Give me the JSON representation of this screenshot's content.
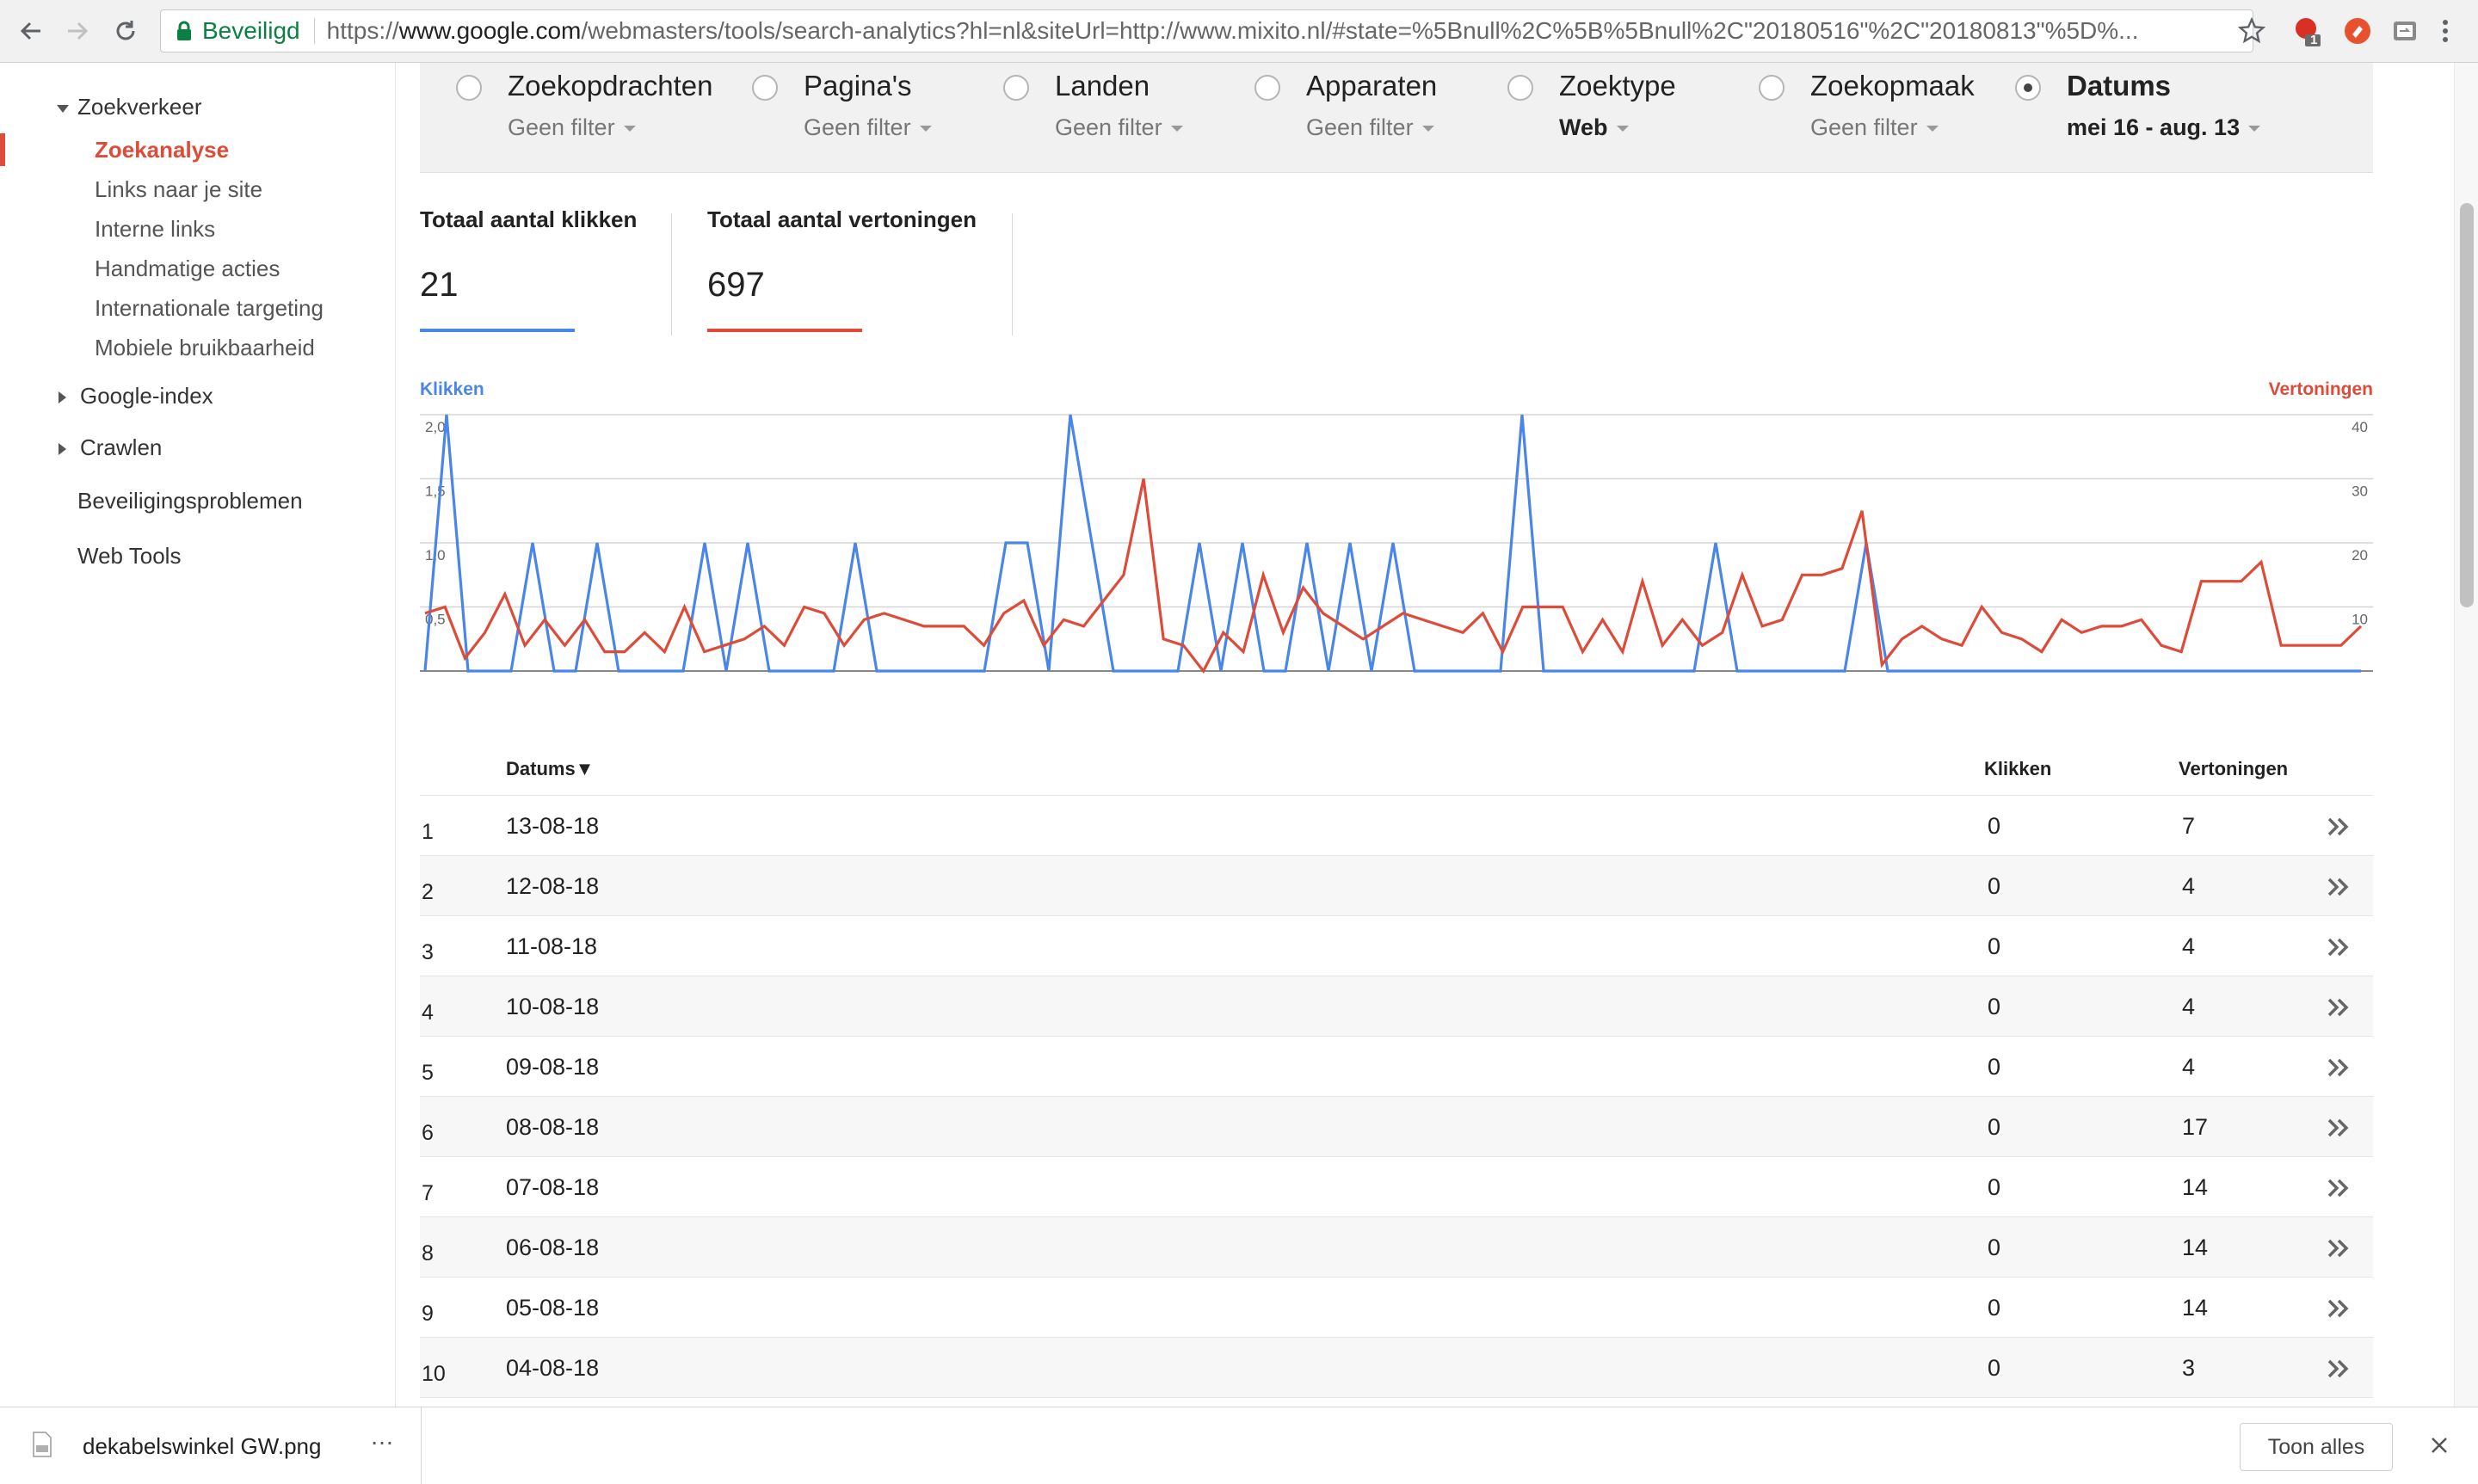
{
  "browser": {
    "secure_label": "Beveiligd",
    "url_prefix": "https://",
    "url_host": "www.google.com",
    "url_rest": "/webmasters/tools/search-analytics?hl=nl&siteUrl=http://www.mixito.nl/#state=%5Bnull%2C%5B%5Bnull%2C\"20180516\"%2C\"20180813\"%5D%...",
    "ext_badge": "1"
  },
  "sidebar": {
    "section": "Zoekverkeer",
    "items": [
      "Zoekanalyse",
      "Links naar je site",
      "Interne links",
      "Handmatige acties",
      "Internationale targeting",
      "Mobiele bruikbaarheid"
    ],
    "groups": [
      "Google-index",
      "Crawlen"
    ],
    "links": [
      "Beveiligingsproblemen",
      "Web Tools"
    ]
  },
  "filters": [
    {
      "label": "Zoekopdrachten",
      "value": "Geen filter",
      "selected": false
    },
    {
      "label": "Pagina's",
      "value": "Geen filter",
      "selected": false
    },
    {
      "label": "Landen",
      "value": "Geen filter",
      "selected": false
    },
    {
      "label": "Apparaten",
      "value": "Geen filter",
      "selected": false
    },
    {
      "label": "Zoektype",
      "value": "Web",
      "selected": false
    },
    {
      "label": "Zoekopmaak",
      "value": "Geen filter",
      "selected": false
    },
    {
      "label": "Datums",
      "value": "mei 16 - aug. 13",
      "selected": true
    }
  ],
  "metrics": [
    {
      "label": "Totaal aantal klikken",
      "value": "21",
      "color": "#4a86e8"
    },
    {
      "label": "Totaal aantal vertoningen",
      "value": "697",
      "color": "#dd4b39"
    }
  ],
  "chart_data": {
    "type": "line",
    "x_start": "2018-05-16",
    "x_end": "2018-08-13",
    "left_axis": {
      "label": "Klikken",
      "color": "#4a86e8",
      "ylim": [
        0,
        2
      ],
      "ticks": [
        "0,5",
        "1,0",
        "1,5",
        "2,0"
      ]
    },
    "right_axis": {
      "label": "Vertoningen",
      "color": "#dd4b39",
      "ylim": [
        0,
        40
      ],
      "ticks": [
        "10",
        "20",
        "30",
        "40"
      ]
    },
    "series": [
      {
        "name": "Klikken",
        "axis": "left",
        "color": "#4a86e8",
        "values": [
          0,
          2,
          0,
          0,
          0,
          1,
          0,
          0,
          1,
          0,
          0,
          0,
          0,
          1,
          0,
          1,
          0,
          0,
          0,
          0,
          1,
          0,
          0,
          0,
          0,
          0,
          0,
          1,
          1,
          0,
          2,
          1,
          0,
          0,
          0,
          0,
          1,
          0,
          1,
          0,
          0,
          1,
          0,
          1,
          0,
          1,
          0,
          0,
          0,
          0,
          0,
          2,
          0,
          0,
          0,
          0,
          0,
          0,
          0,
          0,
          1,
          0,
          0,
          0,
          0,
          0,
          0,
          1,
          0,
          0,
          0,
          0,
          0,
          0,
          0,
          0,
          0,
          0,
          0,
          0,
          0,
          0,
          0,
          0,
          0,
          0,
          0,
          0,
          0,
          0,
          0
        ]
      },
      {
        "name": "Vertoningen",
        "axis": "right",
        "color": "#dd4b39",
        "values": [
          9,
          10,
          2,
          6,
          12,
          4,
          8,
          4,
          8,
          3,
          3,
          6,
          3,
          10,
          3,
          4,
          5,
          7,
          4,
          10,
          9,
          4,
          8,
          9,
          8,
          7,
          7,
          7,
          4,
          9,
          11,
          4,
          8,
          7,
          11,
          15,
          30,
          5,
          4,
          0,
          6,
          3,
          15,
          6,
          13,
          9,
          7,
          5,
          7,
          9,
          8,
          7,
          6,
          9,
          3,
          10,
          10,
          10,
          3,
          8,
          3,
          14,
          4,
          8,
          4,
          6,
          15,
          7,
          8,
          15,
          15,
          16,
          25,
          1,
          5,
          7,
          5,
          4,
          10,
          6,
          5,
          3,
          8,
          6,
          7,
          7,
          8,
          4,
          3,
          14,
          14,
          14,
          17,
          4,
          4,
          4,
          4,
          7
        ]
      }
    ]
  },
  "table": {
    "headers": {
      "date": "Datums▼",
      "clicks": "Klikken",
      "impressions": "Vertoningen"
    },
    "rows": [
      {
        "n": "1",
        "date": "13-08-18",
        "clicks": "0",
        "impressions": "7"
      },
      {
        "n": "2",
        "date": "12-08-18",
        "clicks": "0",
        "impressions": "4"
      },
      {
        "n": "3",
        "date": "11-08-18",
        "clicks": "0",
        "impressions": "4"
      },
      {
        "n": "4",
        "date": "10-08-18",
        "clicks": "0",
        "impressions": "4"
      },
      {
        "n": "5",
        "date": "09-08-18",
        "clicks": "0",
        "impressions": "4"
      },
      {
        "n": "6",
        "date": "08-08-18",
        "clicks": "0",
        "impressions": "17"
      },
      {
        "n": "7",
        "date": "07-08-18",
        "clicks": "0",
        "impressions": "14"
      },
      {
        "n": "8",
        "date": "06-08-18",
        "clicks": "0",
        "impressions": "14"
      },
      {
        "n": "9",
        "date": "05-08-18",
        "clicks": "0",
        "impressions": "14"
      },
      {
        "n": "10",
        "date": "04-08-18",
        "clicks": "0",
        "impressions": "3"
      }
    ]
  },
  "download_bar": {
    "filename": "dekabelswinkel GW.png",
    "more": "…",
    "show_all": "Toon alles"
  }
}
